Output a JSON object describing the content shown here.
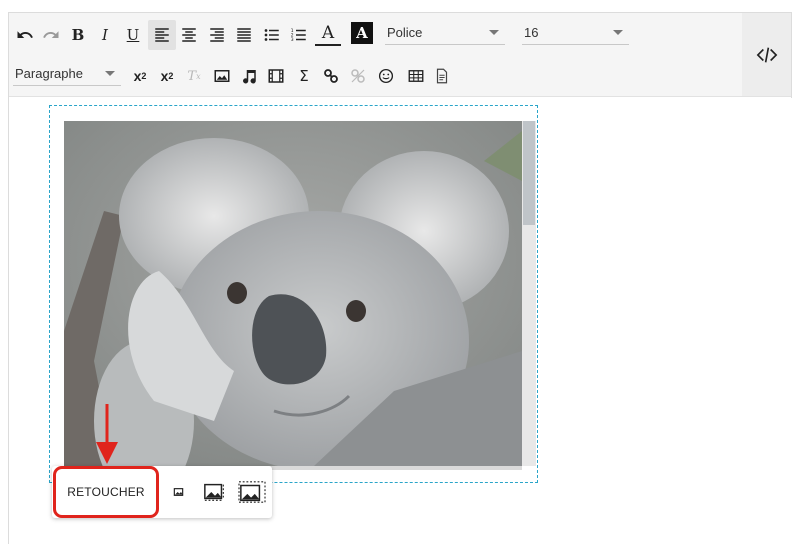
{
  "toolbar": {
    "paragraph_select": "Paragraphe",
    "font_select": "Police",
    "size_select": "16",
    "buttons": [
      {
        "name": "undo"
      },
      {
        "name": "redo"
      },
      {
        "name": "bold",
        "label": "B"
      },
      {
        "name": "italic",
        "label": "I"
      },
      {
        "name": "underline",
        "label": "U"
      },
      {
        "name": "align-left"
      },
      {
        "name": "align-center"
      },
      {
        "name": "align-right"
      },
      {
        "name": "justify"
      },
      {
        "name": "bullet-list"
      },
      {
        "name": "numbered-list"
      },
      {
        "name": "text-color",
        "label": "A"
      },
      {
        "name": "background-color",
        "label": "A"
      },
      {
        "name": "subscript"
      },
      {
        "name": "superscript"
      },
      {
        "name": "clear-format"
      },
      {
        "name": "image"
      },
      {
        "name": "audio"
      },
      {
        "name": "video"
      },
      {
        "name": "special-characters",
        "label": "Σ"
      },
      {
        "name": "link"
      },
      {
        "name": "unlink"
      },
      {
        "name": "emoji"
      },
      {
        "name": "table"
      },
      {
        "name": "document"
      }
    ],
    "subscript_label": "x",
    "subscript_sub": "2",
    "superscript_label": "x",
    "superscript_sup": "2",
    "clear_label": "T",
    "clear_sub": "x",
    "sigma_label": "Σ"
  },
  "image_toolbar": {
    "retouch_label": "RETOUCHER",
    "size_buttons": [
      "small-image-icon",
      "medium-image-icon",
      "large-image-icon"
    ]
  },
  "colors": {
    "accent_dashed": "#2aa5c9",
    "highlight_red": "#e0241c",
    "toolbar_bg": "#f5f5f5"
  }
}
